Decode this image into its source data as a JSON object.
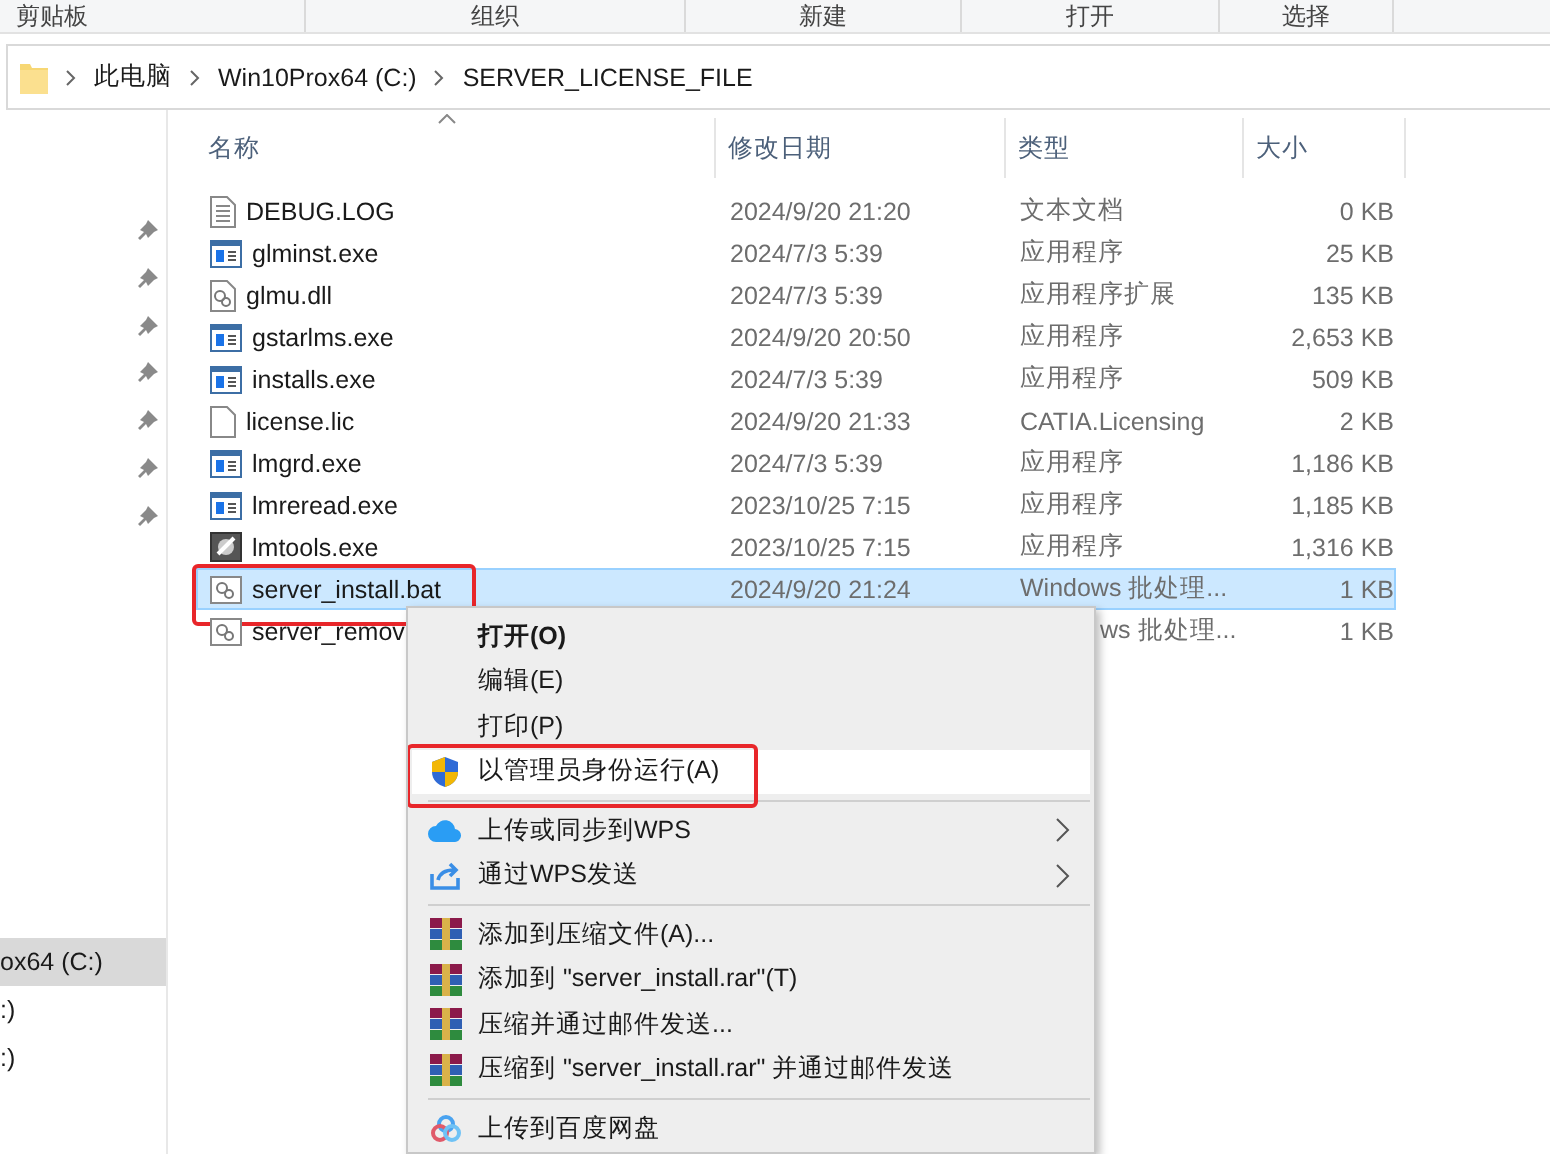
{
  "ribbon": {
    "groups": [
      "剪贴板",
      "组织",
      "新建",
      "打开",
      "选择"
    ]
  },
  "address": {
    "path": [
      "此电脑",
      "Win10Prox64 (C:)",
      "SERVER_LICENSE_FILE"
    ]
  },
  "nav": {
    "items": [
      {
        "label": "ox64 (C:)",
        "selected": true
      },
      {
        "label": ":)",
        "selected": false
      },
      {
        "label": ":)",
        "selected": false
      }
    ]
  },
  "columns": [
    {
      "label": "名称",
      "sorted": true
    },
    {
      "label": "修改日期"
    },
    {
      "label": "类型"
    },
    {
      "label": "大小"
    }
  ],
  "files": [
    {
      "kind": "text",
      "name": "DEBUG.LOG",
      "date": "2024/9/20 21:20",
      "type": "文本文档",
      "size": "0 KB",
      "selected": false
    },
    {
      "kind": "exe",
      "name": "glminst.exe",
      "date": "2024/7/3 5:39",
      "type": "应用程序",
      "size": "25 KB",
      "selected": false
    },
    {
      "kind": "dll",
      "name": "glmu.dll",
      "date": "2024/7/3 5:39",
      "type": "应用程序扩展",
      "size": "135 KB",
      "selected": false
    },
    {
      "kind": "exe",
      "name": "gstarlms.exe",
      "date": "2024/9/20 20:50",
      "type": "应用程序",
      "size": "2,653 KB",
      "selected": false
    },
    {
      "kind": "exe",
      "name": "installs.exe",
      "date": "2024/7/3 5:39",
      "type": "应用程序",
      "size": "509 KB",
      "selected": false
    },
    {
      "kind": "blank",
      "name": "license.lic",
      "date": "2024/9/20 21:33",
      "type": "CATIA.Licensing",
      "size": "2 KB",
      "selected": false
    },
    {
      "kind": "exe",
      "name": "lmgrd.exe",
      "date": "2024/7/3 5:39",
      "type": "应用程序",
      "size": "1,186 KB",
      "selected": false
    },
    {
      "kind": "exe",
      "name": "lmreread.exe",
      "date": "2023/10/25 7:15",
      "type": "应用程序",
      "size": "1,185 KB",
      "selected": false
    },
    {
      "kind": "tool",
      "name": "lmtools.exe",
      "date": "2023/10/25 7:15",
      "type": "应用程序",
      "size": "1,316 KB",
      "selected": false
    },
    {
      "kind": "bat",
      "name": "server_install.bat",
      "date": "2024/9/20 21:24",
      "type": "Windows 批处理...",
      "size": "1 KB",
      "selected": true,
      "annotated": true
    },
    {
      "kind": "bat",
      "name": "server_remov",
      "type": "ws 批处理...",
      "size": "1 KB",
      "selected": false,
      "covered": true
    }
  ],
  "menu": {
    "groups": [
      [
        {
          "kind": "none",
          "label": "打开(O)",
          "bold": true,
          "highlighted": false
        },
        {
          "kind": "none",
          "label": "编辑(E)",
          "highlighted": false
        },
        {
          "kind": "none",
          "label": "打印(P)",
          "highlighted": false
        },
        {
          "kind": "shield",
          "label": "以管理员身份运行(A)",
          "highlighted": true,
          "annotated": true
        }
      ],
      [
        {
          "kind": "cloud",
          "label": "上传或同步到WPS",
          "submenu": true,
          "highlighted": false
        },
        {
          "kind": "share",
          "label": "通过WPS发送",
          "submenu": true,
          "highlighted": false
        }
      ],
      [
        {
          "kind": "rar",
          "label": "添加到压缩文件(A)...",
          "highlighted": false
        },
        {
          "kind": "rar",
          "label": "添加到 \"server_install.rar\"(T)",
          "highlighted": false
        },
        {
          "kind": "rar",
          "label": "压缩并通过邮件发送...",
          "highlighted": false
        },
        {
          "kind": "rar",
          "label": "压缩到 \"server_install.rar\" 并通过邮件发送",
          "highlighted": false
        }
      ],
      [
        {
          "kind": "baidu",
          "label": "上传到百度网盘",
          "highlighted": false
        }
      ]
    ]
  }
}
